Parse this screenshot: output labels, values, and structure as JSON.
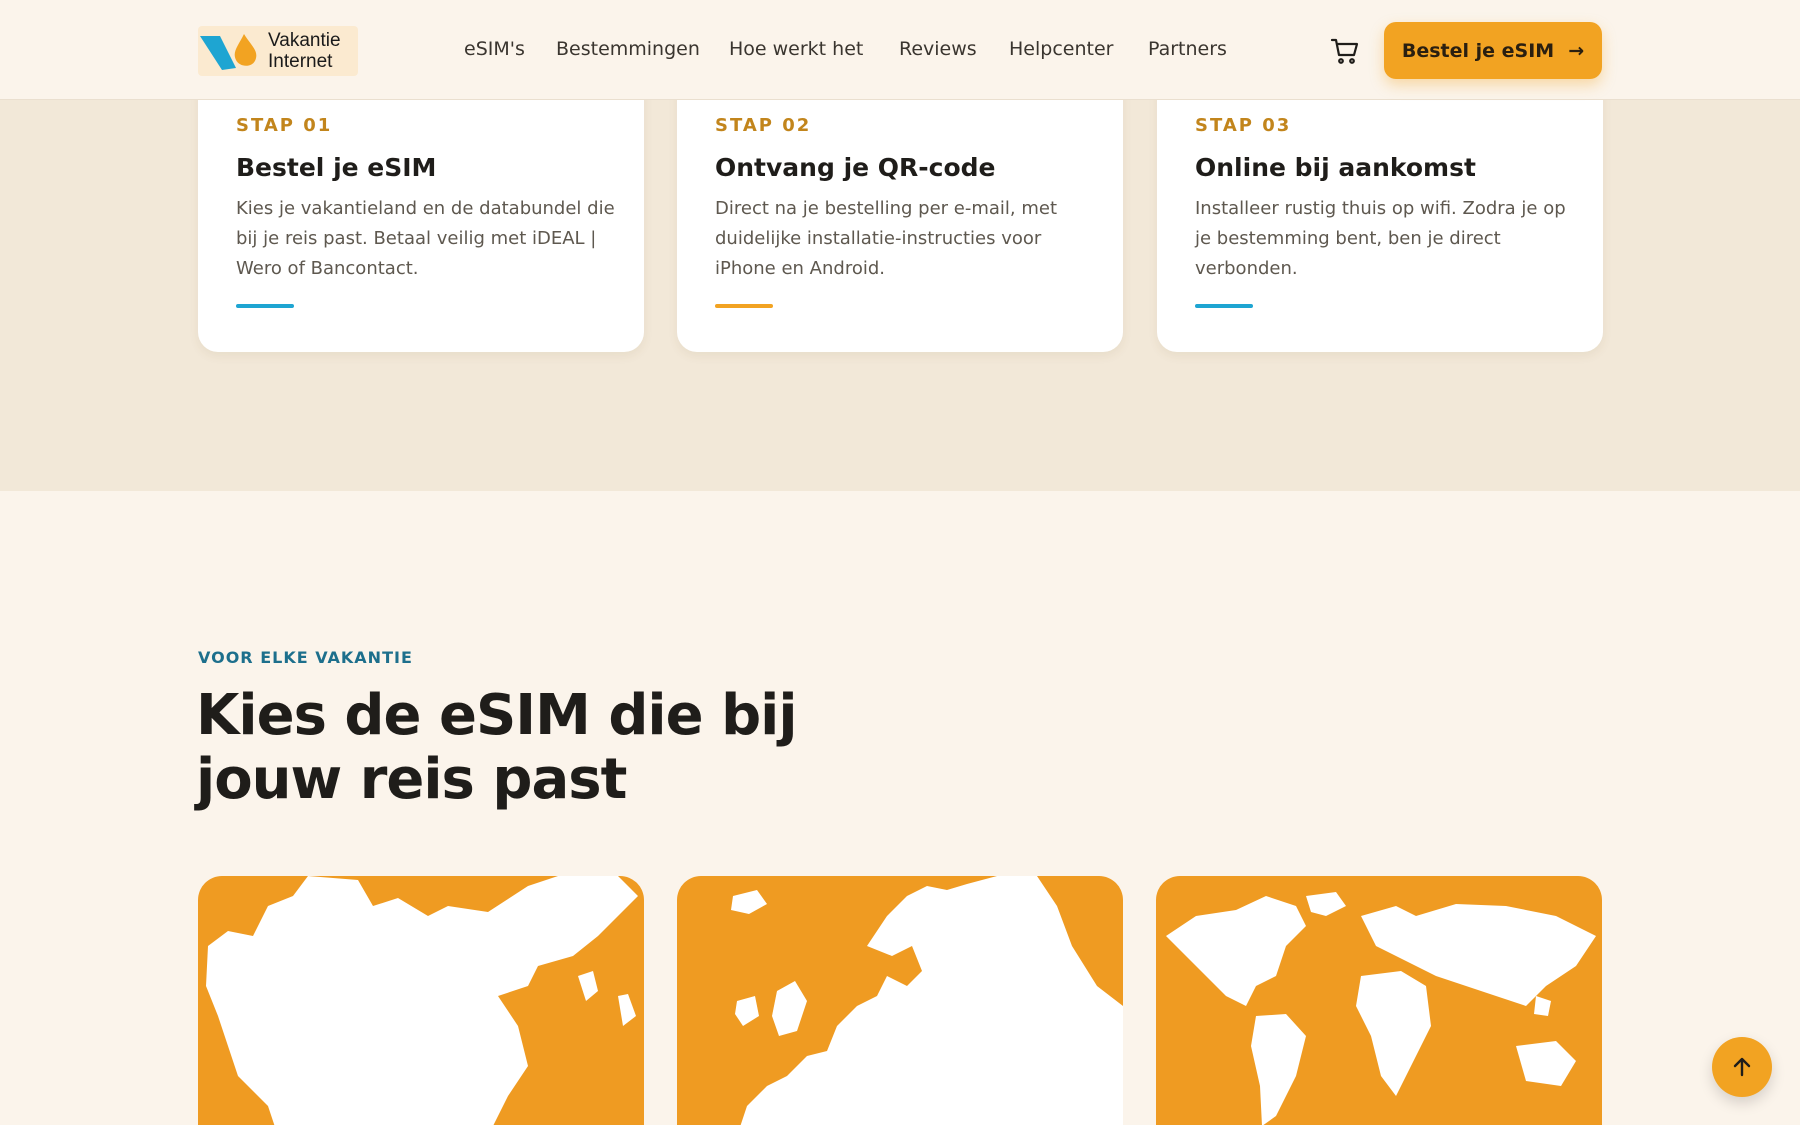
{
  "header": {
    "logo": {
      "line1": "Vakantie",
      "line2": "Internet"
    },
    "nav": [
      "eSIM's",
      "Bestemmingen",
      "Hoe werkt het",
      "Reviews",
      "Helpcenter",
      "Partners"
    ],
    "cta_label": "Bestel je eSIM",
    "cta_arrow": "→"
  },
  "steps": [
    {
      "label": "STAP 01",
      "title": "Bestel je eSIM",
      "description": "Kies je vakantieland en de databundel die bij je reis past. Betaal veilig met iDEAL | Wero of Bancontact.",
      "accent": "#1ea5d2"
    },
    {
      "label": "STAP 02",
      "title": "Ontvang je QR-code",
      "description": "Direct na je bestelling per e-mail, met duidelijke installatie-instructies voor iPhone en Android.",
      "accent": "#f2a322"
    },
    {
      "label": "STAP 03",
      "title": "Online bij aankomst",
      "description": "Installeer rustig thuis op wifi. Zodra je op je bestemming bent, ben je direct verbonden.",
      "accent": "#1ea5d2"
    }
  ],
  "choose": {
    "eyebrow": "VOOR ELKE VAKANTIE",
    "headline_line1": "Kies de eSIM die bij",
    "headline_line2": "jouw reis past",
    "cards": [
      {
        "icon": "china-map-icon"
      },
      {
        "icon": "europe-map-icon"
      },
      {
        "icon": "world-map-icon"
      }
    ]
  },
  "colors": {
    "accent_orange": "#f2a322",
    "accent_blue": "#1ea5d2",
    "map_orange": "#ef9b22",
    "background": "#fbf4eb",
    "band": "#f2e8d8"
  }
}
